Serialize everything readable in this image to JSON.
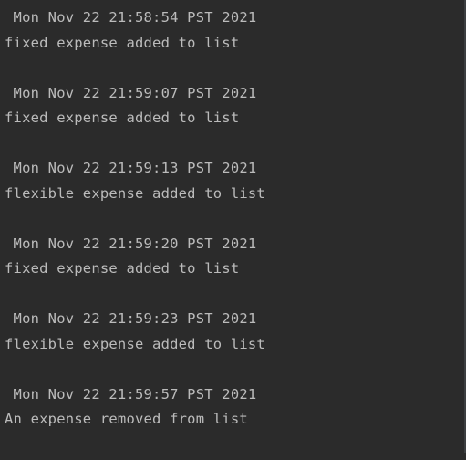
{
  "console": {
    "entries": [
      {
        "timestamp": " Mon Nov 22 21:58:54 PST 2021",
        "message": "fixed expense added to list"
      },
      {
        "timestamp": " Mon Nov 22 21:59:07 PST 2021",
        "message": "fixed expense added to list"
      },
      {
        "timestamp": " Mon Nov 22 21:59:13 PST 2021",
        "message": "flexible expense added to list"
      },
      {
        "timestamp": " Mon Nov 22 21:59:20 PST 2021",
        "message": "fixed expense added to list"
      },
      {
        "timestamp": " Mon Nov 22 21:59:23 PST 2021",
        "message": "flexible expense added to list"
      },
      {
        "timestamp": " Mon Nov 22 21:59:57 PST 2021",
        "message": "An expense removed from list"
      }
    ]
  },
  "colors": {
    "background": "#2b2b2b",
    "text": "#bbbbbb"
  }
}
